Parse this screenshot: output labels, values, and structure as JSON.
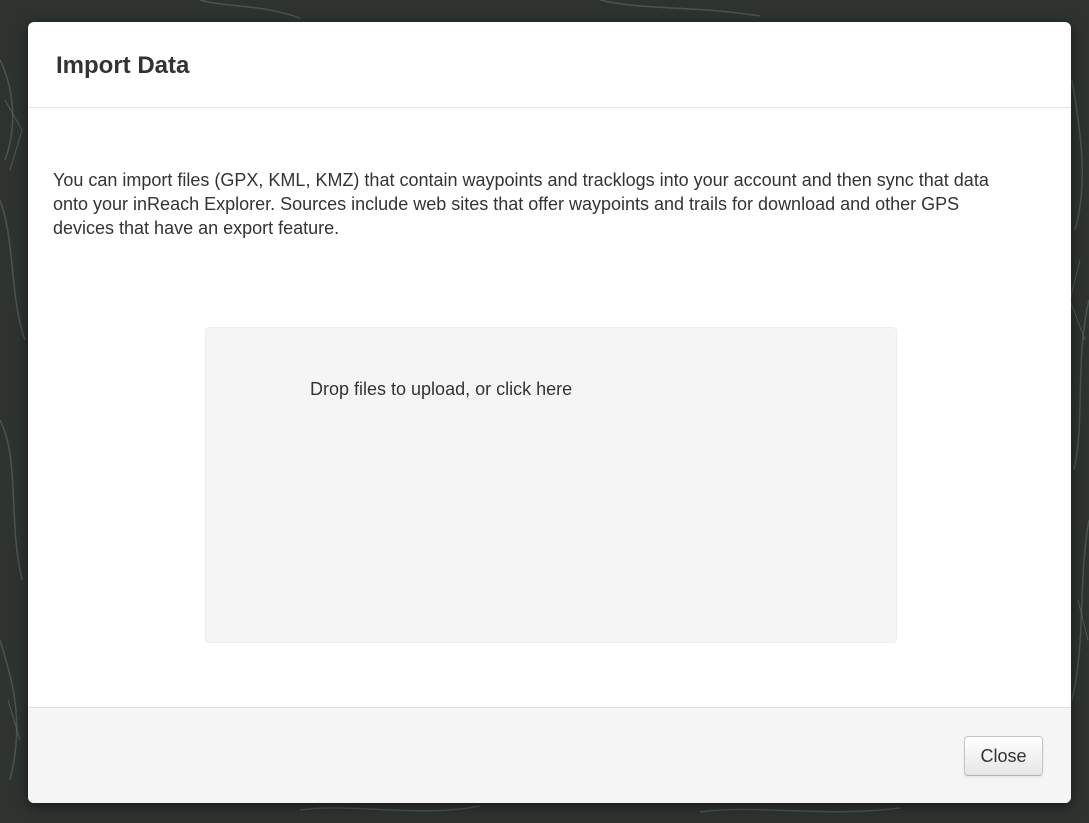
{
  "modal": {
    "title": "Import Data",
    "description": "You can import files (GPX, KML, KMZ) that contain waypoints and tracklogs into your account and then sync that data onto your inReach Explorer. Sources include web sites that offer waypoints and trails for download and other GPS devices that have an export feature.",
    "dropzone_message": "Drop files to upload, or click here",
    "close_label": "Close"
  },
  "colors": {
    "backdrop": "#2e3330",
    "dropzone_bg": "#f5f5f5",
    "footer_bg": "#f5f5f5",
    "text": "#333333"
  }
}
